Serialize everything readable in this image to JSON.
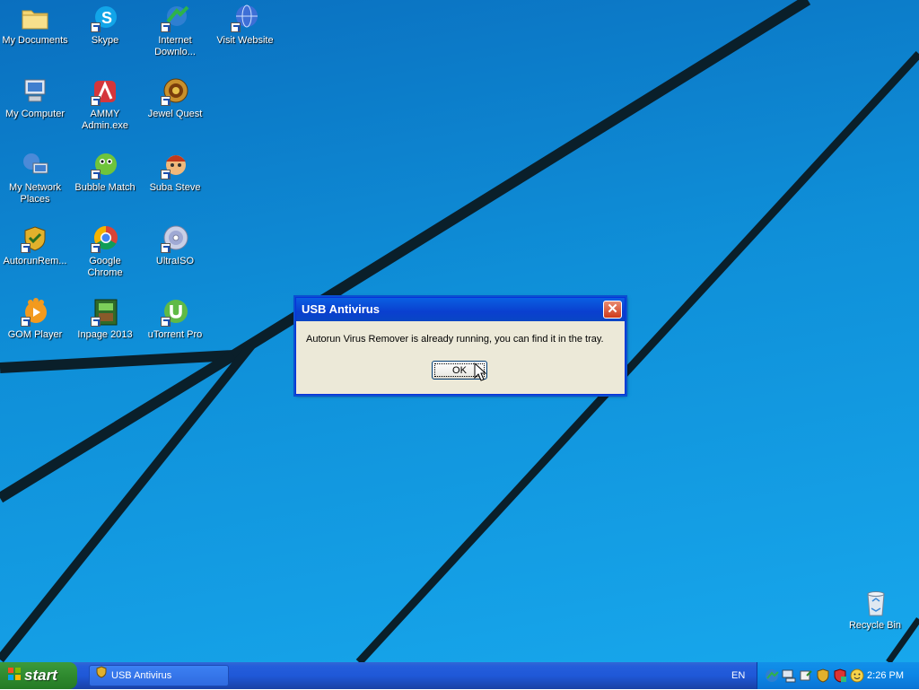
{
  "desktop": {
    "icons": [
      {
        "label": "My Documents",
        "icon": "folder-icon"
      },
      {
        "label": "Skype",
        "icon": "skype-icon"
      },
      {
        "label": "Internet Downlo...",
        "icon": "download-manager-icon"
      },
      {
        "label": "Visit Website",
        "icon": "globe-icon"
      },
      {
        "label": "My Computer",
        "icon": "computer-icon"
      },
      {
        "label": "AMMY Admin.exe",
        "icon": "ammy-admin-icon"
      },
      {
        "label": "Jewel Quest",
        "icon": "jewel-quest-icon"
      },
      {
        "label": "My Network Places",
        "icon": "network-icon"
      },
      {
        "label": "Bubble Match",
        "icon": "bubble-match-icon"
      },
      {
        "label": "Suba Steve",
        "icon": "suba-steve-icon"
      },
      {
        "label": "AutorunRem...",
        "icon": "autorun-remover-icon"
      },
      {
        "label": "Google Chrome",
        "icon": "chrome-icon"
      },
      {
        "label": "UltraISO",
        "icon": "disc-icon"
      },
      {
        "label": "GOM Player",
        "icon": "gom-player-icon"
      },
      {
        "label": "Inpage 2013",
        "icon": "inpage-icon"
      },
      {
        "label": "uTorrent Pro",
        "icon": "utorrent-icon"
      },
      {
        "label": "Recycle Bin",
        "icon": "recycle-bin-icon"
      }
    ]
  },
  "dialog": {
    "title": "USB Antivirus",
    "close_symbol": "✕",
    "message": "Autorun Virus Remover is already running, you can find it in the tray.",
    "ok_label": "OK"
  },
  "taskbar": {
    "start_label": "start",
    "task_button_label": "USB Antivirus",
    "language": "EN",
    "clock": "2:26 PM"
  },
  "colors": {
    "desktop_blue": "#0f8fd8",
    "taskbar_blue": "#245edb",
    "start_green": "#2f8a2f",
    "dialog_face": "#ece9d8",
    "close_red": "#cf3a1b"
  }
}
